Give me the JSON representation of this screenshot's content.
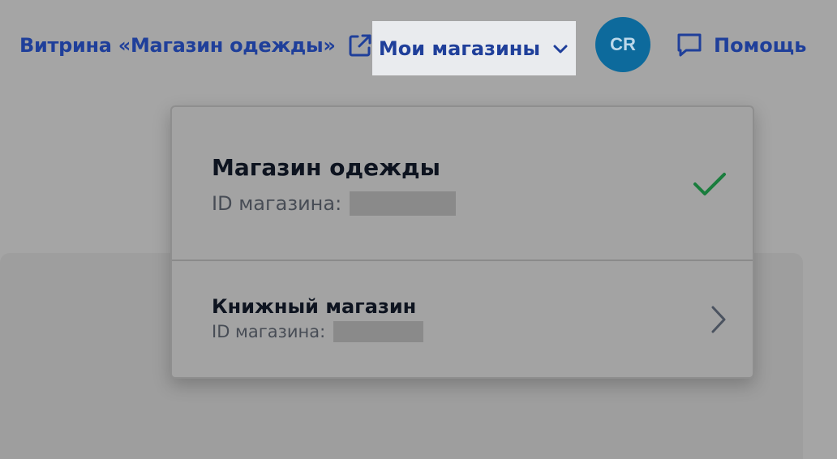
{
  "header": {
    "storefront_link": "Витрина «Магазин одежды»",
    "my_stores": "Мои магазины",
    "avatar_initials": "CR",
    "help": "Помощь"
  },
  "dropdown": {
    "stores": [
      {
        "name": "Магазин одежды",
        "id_label": "ID магазина:",
        "selected": true
      },
      {
        "name": "Книжный магазин",
        "id_label": "ID магазина:",
        "selected": false
      }
    ]
  },
  "colors": {
    "accent": "#1f3f9a",
    "avatar": "#0d6a9c",
    "check": "#1a7d3d",
    "overlay_bg": "#a5a5a5"
  },
  "icons": {
    "external": "external-link-icon",
    "dropdown": "chevron-down-icon",
    "help": "chat-bubble-icon",
    "selected": "check-icon",
    "navigate": "chevron-right-icon"
  }
}
